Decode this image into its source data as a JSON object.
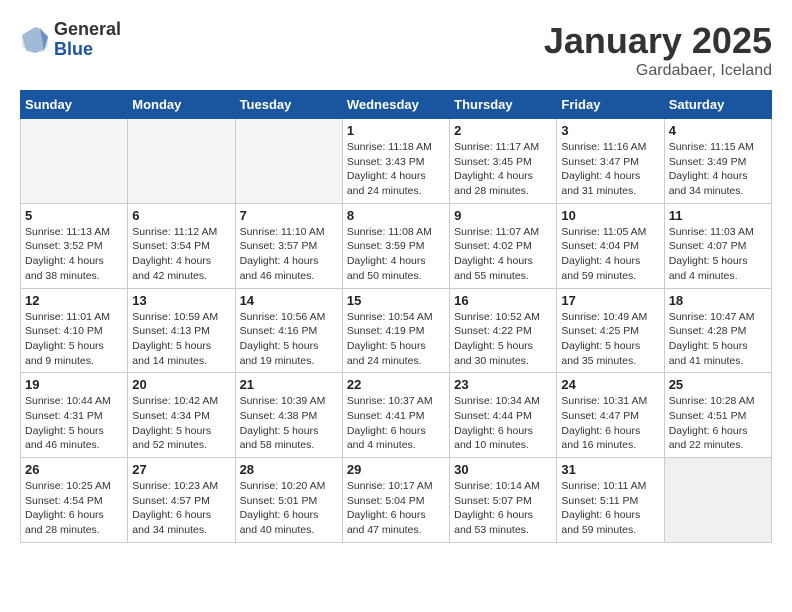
{
  "logo": {
    "general": "General",
    "blue": "Blue"
  },
  "header": {
    "title": "January 2025",
    "subtitle": "Gardabaer, Iceland"
  },
  "weekdays": [
    "Sunday",
    "Monday",
    "Tuesday",
    "Wednesday",
    "Thursday",
    "Friday",
    "Saturday"
  ],
  "weeks": [
    [
      {
        "day": "",
        "info": ""
      },
      {
        "day": "",
        "info": ""
      },
      {
        "day": "",
        "info": ""
      },
      {
        "day": "1",
        "info": "Sunrise: 11:18 AM\nSunset: 3:43 PM\nDaylight: 4 hours and 24 minutes."
      },
      {
        "day": "2",
        "info": "Sunrise: 11:17 AM\nSunset: 3:45 PM\nDaylight: 4 hours and 28 minutes."
      },
      {
        "day": "3",
        "info": "Sunrise: 11:16 AM\nSunset: 3:47 PM\nDaylight: 4 hours and 31 minutes."
      },
      {
        "day": "4",
        "info": "Sunrise: 11:15 AM\nSunset: 3:49 PM\nDaylight: 4 hours and 34 minutes."
      }
    ],
    [
      {
        "day": "5",
        "info": "Sunrise: 11:13 AM\nSunset: 3:52 PM\nDaylight: 4 hours and 38 minutes."
      },
      {
        "day": "6",
        "info": "Sunrise: 11:12 AM\nSunset: 3:54 PM\nDaylight: 4 hours and 42 minutes."
      },
      {
        "day": "7",
        "info": "Sunrise: 11:10 AM\nSunset: 3:57 PM\nDaylight: 4 hours and 46 minutes."
      },
      {
        "day": "8",
        "info": "Sunrise: 11:08 AM\nSunset: 3:59 PM\nDaylight: 4 hours and 50 minutes."
      },
      {
        "day": "9",
        "info": "Sunrise: 11:07 AM\nSunset: 4:02 PM\nDaylight: 4 hours and 55 minutes."
      },
      {
        "day": "10",
        "info": "Sunrise: 11:05 AM\nSunset: 4:04 PM\nDaylight: 4 hours and 59 minutes."
      },
      {
        "day": "11",
        "info": "Sunrise: 11:03 AM\nSunset: 4:07 PM\nDaylight: 5 hours and 4 minutes."
      }
    ],
    [
      {
        "day": "12",
        "info": "Sunrise: 11:01 AM\nSunset: 4:10 PM\nDaylight: 5 hours and 9 minutes."
      },
      {
        "day": "13",
        "info": "Sunrise: 10:59 AM\nSunset: 4:13 PM\nDaylight: 5 hours and 14 minutes."
      },
      {
        "day": "14",
        "info": "Sunrise: 10:56 AM\nSunset: 4:16 PM\nDaylight: 5 hours and 19 minutes."
      },
      {
        "day": "15",
        "info": "Sunrise: 10:54 AM\nSunset: 4:19 PM\nDaylight: 5 hours and 24 minutes."
      },
      {
        "day": "16",
        "info": "Sunrise: 10:52 AM\nSunset: 4:22 PM\nDaylight: 5 hours and 30 minutes."
      },
      {
        "day": "17",
        "info": "Sunrise: 10:49 AM\nSunset: 4:25 PM\nDaylight: 5 hours and 35 minutes."
      },
      {
        "day": "18",
        "info": "Sunrise: 10:47 AM\nSunset: 4:28 PM\nDaylight: 5 hours and 41 minutes."
      }
    ],
    [
      {
        "day": "19",
        "info": "Sunrise: 10:44 AM\nSunset: 4:31 PM\nDaylight: 5 hours and 46 minutes."
      },
      {
        "day": "20",
        "info": "Sunrise: 10:42 AM\nSunset: 4:34 PM\nDaylight: 5 hours and 52 minutes."
      },
      {
        "day": "21",
        "info": "Sunrise: 10:39 AM\nSunset: 4:38 PM\nDaylight: 5 hours and 58 minutes."
      },
      {
        "day": "22",
        "info": "Sunrise: 10:37 AM\nSunset: 4:41 PM\nDaylight: 6 hours and 4 minutes."
      },
      {
        "day": "23",
        "info": "Sunrise: 10:34 AM\nSunset: 4:44 PM\nDaylight: 6 hours and 10 minutes."
      },
      {
        "day": "24",
        "info": "Sunrise: 10:31 AM\nSunset: 4:47 PM\nDaylight: 6 hours and 16 minutes."
      },
      {
        "day": "25",
        "info": "Sunrise: 10:28 AM\nSunset: 4:51 PM\nDaylight: 6 hours and 22 minutes."
      }
    ],
    [
      {
        "day": "26",
        "info": "Sunrise: 10:25 AM\nSunset: 4:54 PM\nDaylight: 6 hours and 28 minutes."
      },
      {
        "day": "27",
        "info": "Sunrise: 10:23 AM\nSunset: 4:57 PM\nDaylight: 6 hours and 34 minutes."
      },
      {
        "day": "28",
        "info": "Sunrise: 10:20 AM\nSunset: 5:01 PM\nDaylight: 6 hours and 40 minutes."
      },
      {
        "day": "29",
        "info": "Sunrise: 10:17 AM\nSunset: 5:04 PM\nDaylight: 6 hours and 47 minutes."
      },
      {
        "day": "30",
        "info": "Sunrise: 10:14 AM\nSunset: 5:07 PM\nDaylight: 6 hours and 53 minutes."
      },
      {
        "day": "31",
        "info": "Sunrise: 10:11 AM\nSunset: 5:11 PM\nDaylight: 6 hours and 59 minutes."
      },
      {
        "day": "",
        "info": ""
      }
    ]
  ]
}
